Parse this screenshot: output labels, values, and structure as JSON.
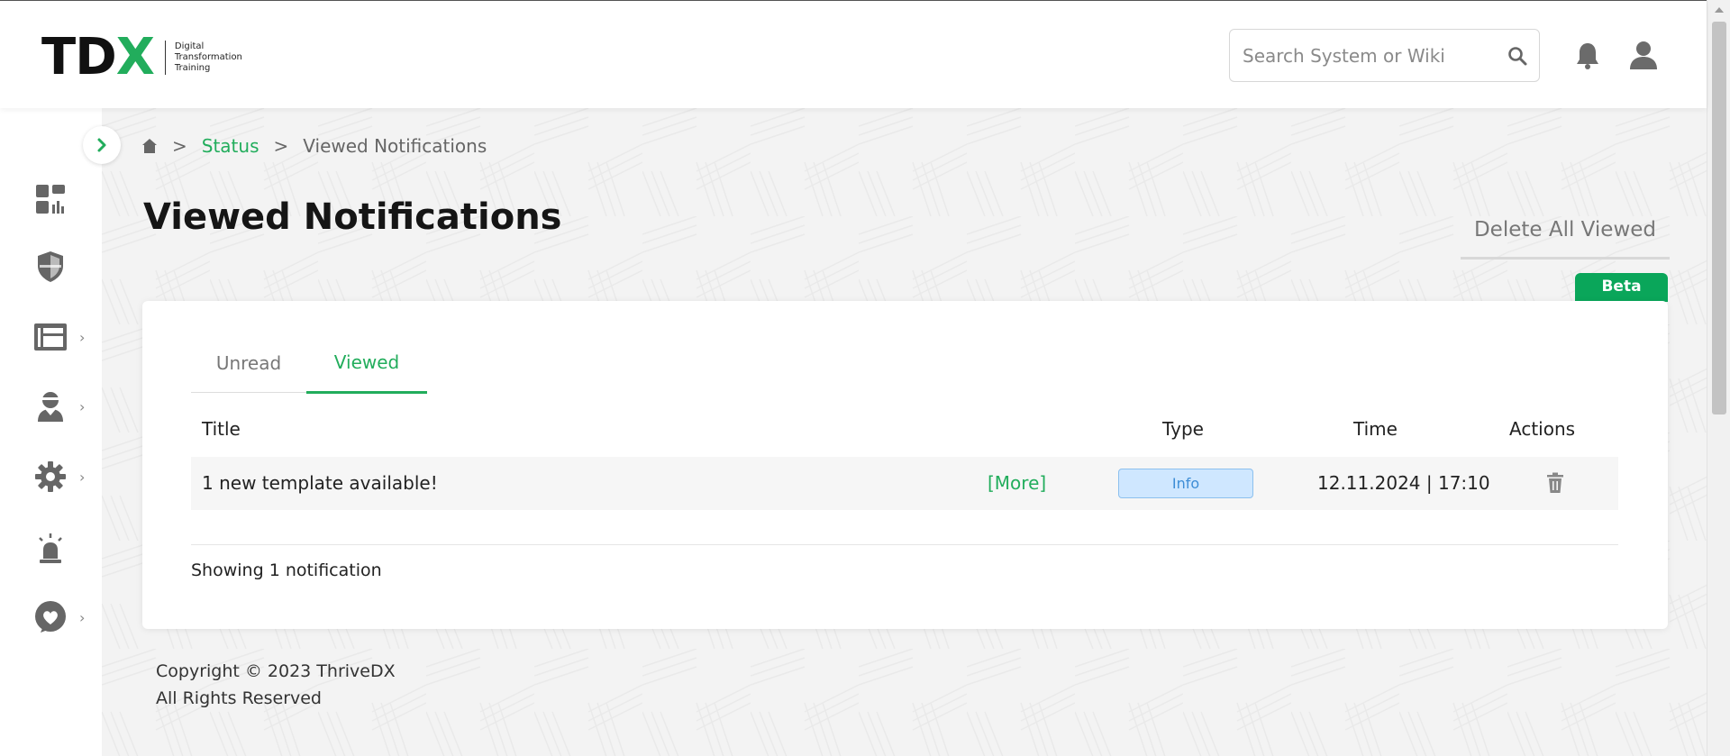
{
  "brand": {
    "logo_t": "T",
    "logo_d": "D",
    "logo_x": "X",
    "logo_line1": "Digital",
    "logo_line2": "Transformation",
    "logo_line3": "Training",
    "accent": "#22ad5c"
  },
  "header": {
    "search_placeholder": "Search System or Wiki",
    "icons": [
      "search-icon",
      "bell-icon",
      "user-icon"
    ]
  },
  "sidebar": {
    "items": [
      {
        "name": "dashboard",
        "icon": "dashboard-icon",
        "has_submenu": false
      },
      {
        "name": "security",
        "icon": "shield-icon",
        "has_submenu": false
      },
      {
        "name": "content",
        "icon": "layout-icon",
        "has_submenu": true
      },
      {
        "name": "users",
        "icon": "user-group-icon",
        "has_submenu": true
      },
      {
        "name": "settings",
        "icon": "gear-icon",
        "has_submenu": true
      },
      {
        "name": "alerts",
        "icon": "siren-icon",
        "has_submenu": false
      },
      {
        "name": "health",
        "icon": "heart-icon",
        "has_submenu": true
      }
    ],
    "chevron": "›"
  },
  "breadcrumb": {
    "separator": ">",
    "link": "Status",
    "current": "Viewed Notifications"
  },
  "page": {
    "title": "Viewed Notifications",
    "delete_all_label": "Delete All Viewed",
    "beta_label": "Beta"
  },
  "tabs": [
    {
      "label": "Unread",
      "active": false
    },
    {
      "label": "Viewed",
      "active": true
    }
  ],
  "table": {
    "headers": {
      "title": "Title",
      "type": "Type",
      "time": "Time",
      "actions": "Actions"
    },
    "rows": [
      {
        "title": "1 new template available!",
        "more": "[More]",
        "type": "Info",
        "time": "12.11.2024 | 17:10"
      }
    ],
    "type_colors": {
      "info_bg": "#cfe7ff",
      "info_text": "#3d8dd6"
    }
  },
  "summary": "Showing 1 notification",
  "footer": {
    "copyright": "Copyright © 2023 ThriveDX",
    "rights": "All Rights Reserved"
  }
}
